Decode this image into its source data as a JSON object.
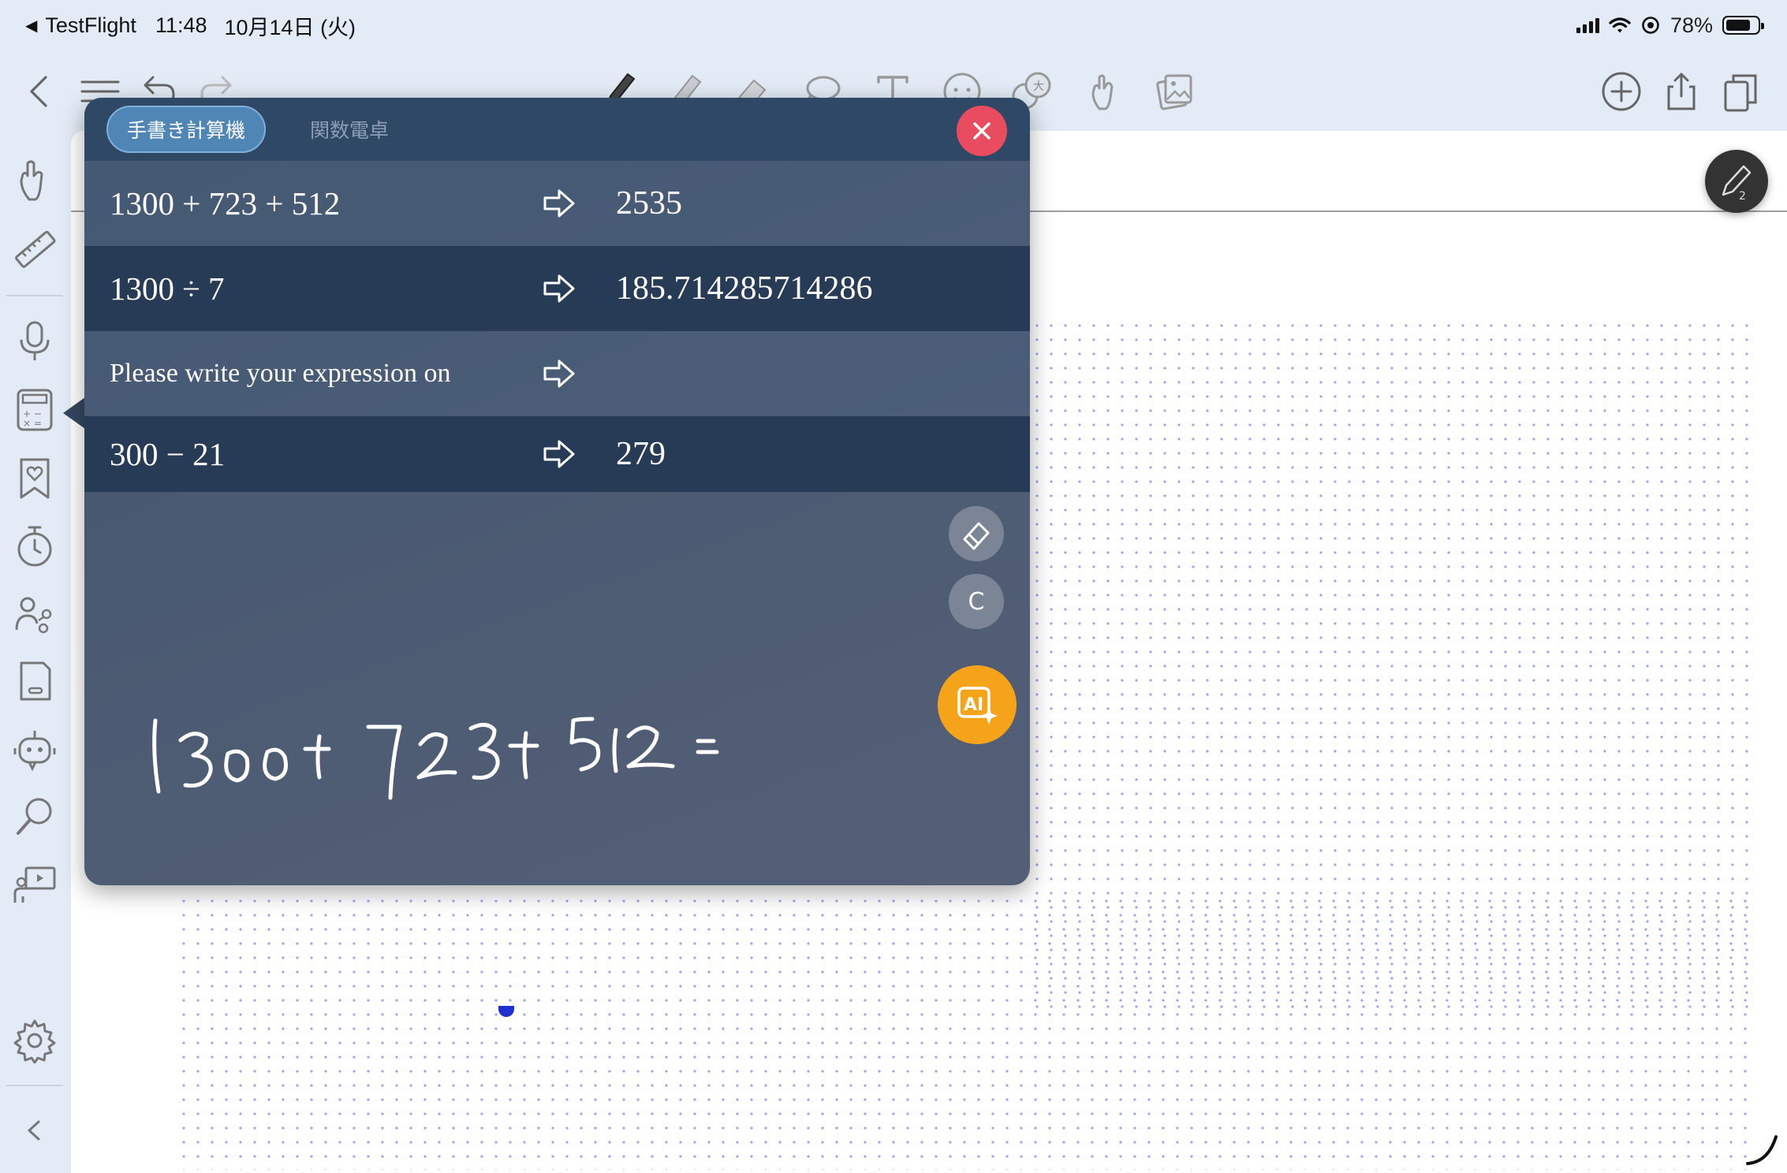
{
  "status_bar": {
    "back_app": "TestFlight",
    "time": "11:48",
    "date": "10月14日 (火)",
    "battery_percent": "78%",
    "battery_level": 0.78
  },
  "toolbar": {
    "left_icons": [
      "back-icon",
      "menu-icon",
      "undo-icon",
      "redo-icon"
    ],
    "tool_icons": [
      "pen-icon",
      "highlighter-icon",
      "eraser-icon",
      "lasso-icon",
      "text-icon",
      "sticker-icon",
      "translate-icon",
      "hand-icon",
      "image-icon"
    ],
    "right_icons": [
      "add-page-icon",
      "share-icon",
      "pages-icon"
    ]
  },
  "sidebar": {
    "icons": [
      "hand-icon",
      "ruler-icon",
      "microphone-icon",
      "calculator-icon",
      "bookmark-heart-icon",
      "timer-icon",
      "collaboration-icon",
      "document-icon",
      "robot-icon",
      "search-icon",
      "presentation-icon",
      "settings-icon",
      "collapse-icon"
    ]
  },
  "pen_badge": {
    "label": "2"
  },
  "calculator": {
    "tabs": [
      {
        "label": "手書き計算機",
        "active": true
      },
      {
        "label": "関数電卓",
        "active": false
      }
    ],
    "history": [
      {
        "expression": "1300 + 723 + 512",
        "result": "2535"
      },
      {
        "expression": "1300 ÷ 7",
        "result": "185.714285714286"
      },
      {
        "expression": "Please write your expression on",
        "result": ""
      },
      {
        "expression": "300 − 21",
        "result": "279"
      }
    ],
    "clear_label": "C",
    "colors": {
      "close": "#e94b5f",
      "ai": "#f5a318",
      "active_tab": "#4f86b6"
    }
  }
}
